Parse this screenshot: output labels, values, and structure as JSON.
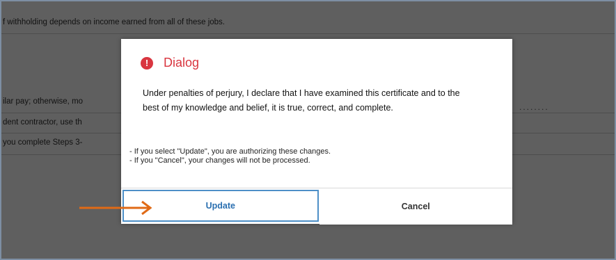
{
  "background": {
    "rows": [
      "f withholding depends on income earned from all of these jobs.",
      "ilar pay; otherwise, mo",
      "dent contractor, use th",
      "you complete Steps 3-"
    ],
    "dots": "........"
  },
  "dialog": {
    "icon": "exclamation-icon",
    "title": "Dialog",
    "body": "Under penalties of perjury, I declare that I have examined this certificate and to the best of my knowledge and belief, it is true, correct, and complete.",
    "notes": [
      "-  If you select \"Update\", you are authorizing these changes.",
      "-  If you \"Cancel\", your changes will not be processed."
    ],
    "update_label": "Update",
    "cancel_label": "Cancel"
  },
  "colors": {
    "accent": "#d9353f",
    "button_border": "#4d8fc7",
    "arrow": "#e06a16",
    "overlay": "#5f5f5f"
  }
}
